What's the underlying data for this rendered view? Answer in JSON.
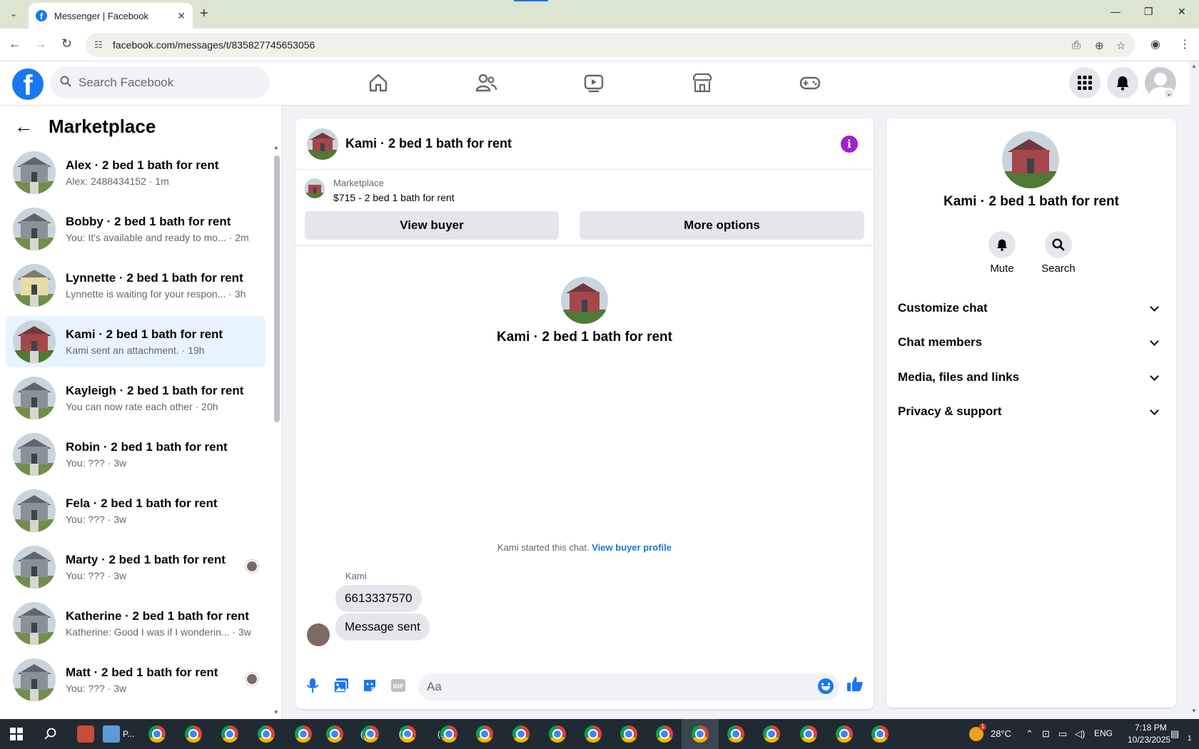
{
  "browser": {
    "tab_title": "Messenger | Facebook",
    "url": "facebook.com/messages/t/835827745653056"
  },
  "fbnav": {
    "search_placeholder": "Search Facebook"
  },
  "sidebar": {
    "title": "Marketplace",
    "conversations": [
      {
        "name": "Alex · 2 bed 1 bath for rent",
        "preview": "Alex: 2488434152 · 1m",
        "thumb": "house-gray",
        "seen": false,
        "active": false
      },
      {
        "name": "Bobby · 2 bed 1 bath for rent",
        "preview": "You: It's available and ready to mo... · 2m",
        "thumb": "house-gray",
        "seen": false,
        "active": false
      },
      {
        "name": "Lynnette · 2 bed 1 bath for rent",
        "preview": "Lynnette is waiting for your respon... · 3h",
        "thumb": "house-yellow",
        "seen": false,
        "active": false
      },
      {
        "name": "Kami · 2 bed 1 bath for rent",
        "preview": "Kami sent an attachment. · 19h",
        "thumb": "house-red",
        "seen": false,
        "active": true
      },
      {
        "name": "Kayleigh · 2 bed 1 bath for rent",
        "preview": "You can now rate each other · 20h",
        "thumb": "house-gray",
        "seen": false,
        "active": false
      },
      {
        "name": "Robin · 2 bed 1 bath for rent",
        "preview": "You: ??? · 3w",
        "thumb": "house-gray",
        "seen": false,
        "active": false
      },
      {
        "name": "Fela · 2 bed 1 bath for rent",
        "preview": "You: ??? · 3w",
        "thumb": "house-gray",
        "seen": false,
        "active": false
      },
      {
        "name": "Marty · 2 bed 1 bath for rent",
        "preview": "You: ??? · 3w",
        "thumb": "house-gray",
        "seen": true,
        "active": false
      },
      {
        "name": "Katherine · 2 bed 1 bath for rent",
        "preview": "Katherine: Good I was if I wonderin... · 3w",
        "thumb": "house-gray",
        "seen": false,
        "active": false
      },
      {
        "name": "Matt · 2 bed 1 bath for rent",
        "preview": "You: ??? · 3w",
        "thumb": "house-gray",
        "seen": true,
        "active": false
      }
    ]
  },
  "chat": {
    "title": "Kami · 2 bed 1 bath for rent",
    "listing_source": "Marketplace",
    "listing_price": "$715 - 2 bed 1 bath for rent",
    "view_buyer_label": "View buyer",
    "more_options_label": "More options",
    "intro_name": "Kami · 2 bed 1 bath for rent",
    "started_text": "Kami started this chat.",
    "view_profile_link": "View buyer profile",
    "sender_name": "Kami",
    "messages": [
      "6613337570",
      "Message sent"
    ],
    "composer_placeholder": "Aa"
  },
  "info": {
    "name": "Kami · 2 bed 1 bath for rent",
    "mute_label": "Mute",
    "search_label": "Search",
    "sections": [
      "Customize chat",
      "Chat members",
      "Media, files and links",
      "Privacy & support"
    ]
  },
  "taskbar": {
    "task_label_1": "P...",
    "task_label_2": "(...",
    "task_label_3": "(...",
    "task_label_4": "(...",
    "weather": "28°C",
    "lang": "ENG",
    "time": "7:18 PM",
    "date": "10/23/2025",
    "notification_count": "1",
    "weather_alert": "1"
  },
  "colors": {
    "fb_blue": "#1877f2",
    "active_conv_bg": "#e7f3ff",
    "info_purple": "#a020c8",
    "link_blue": "#1b74e4"
  }
}
